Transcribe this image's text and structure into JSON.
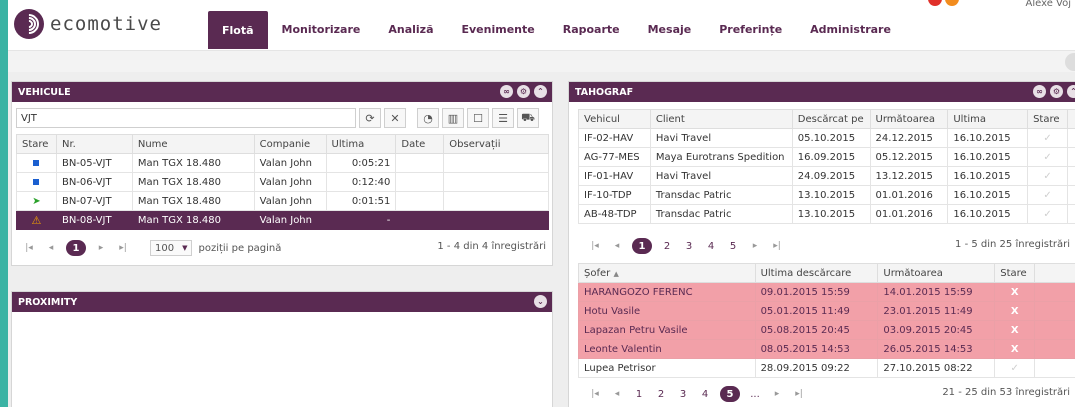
{
  "app": {
    "logo_text": "ecomotive",
    "user_name": "Alexe Voj"
  },
  "nav": {
    "items": [
      {
        "label": "Flotă",
        "active": true
      },
      {
        "label": "Monitorizare"
      },
      {
        "label": "Analiză"
      },
      {
        "label": "Evenimente"
      },
      {
        "label": "Rapoarte"
      },
      {
        "label": "Mesaje"
      },
      {
        "label": "Preferințe"
      },
      {
        "label": "Administrare"
      }
    ]
  },
  "vehicule": {
    "title": "VEHICULE",
    "search_value": "VJT",
    "columns": [
      "Stare",
      "Nr.",
      "Nume",
      "Companie",
      "Ultima",
      "Date",
      "Observații"
    ],
    "rows": [
      {
        "status": "square",
        "nr": "BN-05-VJT",
        "nume": "Man TGX 18.480",
        "companie": "Valan John",
        "ultima": "0:05:21",
        "date": "",
        "obs": ""
      },
      {
        "status": "square",
        "nr": "BN-06-VJT",
        "nume": "Man TGX 18.480",
        "companie": "Valan John",
        "ultima": "0:12:40",
        "date": "",
        "obs": ""
      },
      {
        "status": "arrow",
        "nr": "BN-07-VJT",
        "nume": "Man TGX 18.480",
        "companie": "Valan John",
        "ultima": "0:01:51",
        "date": "",
        "obs": ""
      },
      {
        "status": "warning",
        "nr": "BN-08-VJT",
        "nume": "Man TGX 18.480",
        "companie": "Valan John",
        "ultima": "-",
        "date": "",
        "obs": "",
        "selected": true
      }
    ],
    "pager": {
      "current": "1",
      "per_page": "100",
      "per_page_label": "poziții pe pagină",
      "summary": "1 - 4 din 4 înregistrări"
    }
  },
  "proximity": {
    "title": "PROXIMITY"
  },
  "tahograf": {
    "title": "TAHOGRAF",
    "columns": [
      "Vehicul",
      "Client",
      "Descărcat pe",
      "Următoarea",
      "Ultima",
      "Stare"
    ],
    "rows": [
      {
        "vehicul": "IF-02-HAV",
        "client": "Havi Travel",
        "descarcat": "05.10.2015",
        "urmatoarea": "24.12.2015",
        "ultima": "16.10.2015"
      },
      {
        "vehicul": "AG-77-MES",
        "client": "Maya Eurotrans Spedition",
        "descarcat": "16.09.2015",
        "urmatoarea": "05.12.2015",
        "ultima": "16.10.2015"
      },
      {
        "vehicul": "IF-01-HAV",
        "client": "Havi Travel",
        "descarcat": "24.09.2015",
        "urmatoarea": "13.12.2015",
        "ultima": "16.10.2015"
      },
      {
        "vehicul": "IF-10-TDP",
        "client": "Transdac Patric",
        "descarcat": "13.10.2015",
        "urmatoarea": "01.01.2016",
        "ultima": "16.10.2015"
      },
      {
        "vehicul": "AB-48-TDP",
        "client": "Transdac Patric",
        "descarcat": "13.10.2015",
        "urmatoarea": "01.01.2016",
        "ultima": "16.10.2015"
      }
    ],
    "check_glyph": "✓",
    "pager": {
      "pages": [
        "2",
        "3",
        "4",
        "5"
      ],
      "current": "1",
      "summary": "1 - 5 din 25 înregistrări"
    }
  },
  "soferi": {
    "columns": [
      "Șofer",
      "Ultima descărcare",
      "Următoarea",
      "Stare"
    ],
    "rows": [
      {
        "name": "HARANGOZO FERENC",
        "ultima": "09.01.2015 15:59",
        "urmatoarea": "14.01.2015 15:59",
        "stare": "X",
        "red": true
      },
      {
        "name": "Hotu Vasile",
        "ultima": "05.01.2015 11:49",
        "urmatoarea": "23.01.2015 11:49",
        "stare": "X",
        "red": true
      },
      {
        "name": "Lapazan Petru Vasile",
        "ultima": "05.08.2015 20:45",
        "urmatoarea": "03.09.2015 20:45",
        "stare": "X",
        "red": true
      },
      {
        "name": "Leonte Valentin",
        "ultima": "08.05.2015 14:53",
        "urmatoarea": "26.05.2015 14:53",
        "stare": "X",
        "red": true
      },
      {
        "name": "Lupea Petrisor",
        "ultima": "28.09.2015 09:22",
        "urmatoarea": "27.10.2015 08:22",
        "stare": "✓",
        "red": false
      }
    ],
    "pager": {
      "pages_before": [
        "1",
        "2",
        "3",
        "4"
      ],
      "current": "5",
      "ellipsis": "...",
      "summary": "21 - 25 din 53 înregistrări"
    }
  }
}
